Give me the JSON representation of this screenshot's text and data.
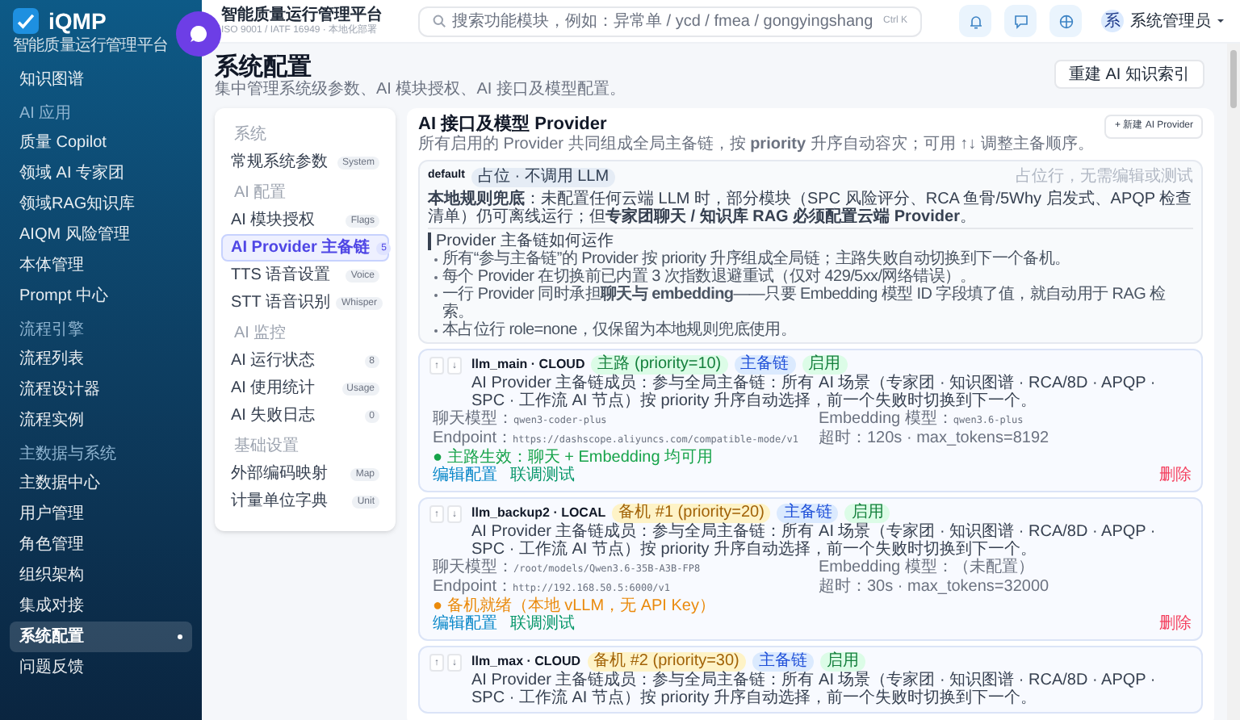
{
  "sidebar": {
    "logo_title": "iQMP",
    "logo_subtitle": "智能质量运行管理平台",
    "items": [
      {
        "kind": "item",
        "label": "知识图谱",
        "selected": false
      },
      {
        "kind": "heading",
        "label": "AI 应用"
      },
      {
        "kind": "item",
        "label": "质量 Copilot",
        "selected": false
      },
      {
        "kind": "item",
        "label": "领域 AI 专家团",
        "selected": false
      },
      {
        "kind": "item",
        "label": "领域RAG知识库",
        "selected": false
      },
      {
        "kind": "item",
        "label": "AIQM 风险管理",
        "selected": false
      },
      {
        "kind": "item",
        "label": "本体管理",
        "selected": false
      },
      {
        "kind": "item",
        "label": "Prompt 中心",
        "selected": false
      },
      {
        "kind": "heading",
        "label": "流程引擎"
      },
      {
        "kind": "item",
        "label": "流程列表",
        "selected": false
      },
      {
        "kind": "item",
        "label": "流程设计器",
        "selected": false
      },
      {
        "kind": "item",
        "label": "流程实例",
        "selected": false
      },
      {
        "kind": "heading",
        "label": "主数据与系统"
      },
      {
        "kind": "item",
        "label": "主数据中心",
        "selected": false
      },
      {
        "kind": "item",
        "label": "用户管理",
        "selected": false
      },
      {
        "kind": "item",
        "label": "角色管理",
        "selected": false
      },
      {
        "kind": "item",
        "label": "组织架构",
        "selected": false
      },
      {
        "kind": "item",
        "label": "集成对接",
        "selected": false
      },
      {
        "kind": "item",
        "label": "系统配置",
        "selected": true
      },
      {
        "kind": "item",
        "label": "问题反馈",
        "selected": false
      }
    ]
  },
  "header": {
    "title": "智能质量运行管理平台",
    "subtitle": "ISO 9001 / IATF 16949 · 本地化部署",
    "search": {
      "placeholder": "搜索功能模块，例如：异常单 / ycd / fmea / gongyingshang",
      "shortcut": "Ctrl K"
    },
    "user": {
      "avatar": "系",
      "name": "系统管理员"
    }
  },
  "page": {
    "title": "系统配置",
    "subtitle": "集中管理系统级参数、AI 模块授权、AI 接口及模型配置。",
    "button": "重建 AI 知识索引"
  },
  "config_nav": [
    {
      "heading": "系统",
      "items": [
        {
          "label": "常规系统参数",
          "badge": "System",
          "selected": false
        }
      ]
    },
    {
      "heading": "AI 配置",
      "items": [
        {
          "label": "AI 模块授权",
          "badge": "Flags",
          "selected": false
        },
        {
          "label": "AI Provider 主备链",
          "badge": "5",
          "selected": true
        },
        {
          "label": "TTS 语音设置",
          "badge": "Voice",
          "selected": false
        },
        {
          "label": "STT 语音识别",
          "badge": "Whisper",
          "selected": false
        }
      ]
    },
    {
      "heading": "AI 监控",
      "items": [
        {
          "label": "AI 运行状态",
          "badge": "8",
          "selected": false
        },
        {
          "label": "AI 使用统计",
          "badge": "Usage",
          "selected": false
        },
        {
          "label": "AI 失败日志",
          "badge": "0",
          "selected": false
        }
      ]
    },
    {
      "heading": "基础设置",
      "items": [
        {
          "label": "外部编码映射",
          "badge": "Map",
          "selected": false
        },
        {
          "label": "计量单位字典",
          "badge": "Unit",
          "selected": false
        }
      ]
    }
  ],
  "panel": {
    "title": "AI 接口及模型 Provider",
    "description": "所有启用的 Provider 共同组成全局主备链，按 **priority** 升序自动容灾；可用 ↑↓ 调整主备顺序。",
    "new_button": "+ 新建 AI Provider",
    "default_card": {
      "name": "default",
      "tag": "占位 · 不调用 LLM",
      "note": "占位行，无需编辑或测试",
      "notice": "**本地规则兜底**：未配置任何云端 LLM 时，部分模块（SPC 风险评分、RCA 鱼骨/5Why 启发式、APQP 检查清单）仍可离线运行；但**专家团聊天 / 知识库 RAG 必须配置云端 Provider**。",
      "help_title": "Provider 主备链如何运作",
      "help_items": [
        "所有“参与主备链”的 Provider 按 priority 升序组成全局链；主路失败自动切换到下一个备机。",
        "每个 Provider 在切换前已内置 3 次指数退避重试（仅对 429/5xx/网络错误）。",
        "一行 Provider 同时承担**聊天与 embedding**——只要 Embedding 模型 ID 字段填了值，就自动用于 RAG 检索。",
        "本占位行 role=none，仅保留为本地规则兜底使用。"
      ]
    },
    "providers": [
      {
        "up": "↑",
        "down": "↓",
        "name": "llm_main · CLOUD",
        "role": {
          "kind": "primary",
          "text": "主路 (priority=10)"
        },
        "chain": "主备链",
        "enabled": "启用",
        "description": "AI Provider 主备链成员：参与全局主备链：所有 AI 场景（专家团 · 知识图谱 · RCA/8D · APQP · SPC · 工作流 AI 节点）按 priority 升序自动选择，前一个失败时切换到下一个。",
        "fields": [
          {
            "label": "聊天模型：",
            "value": "qwen3-coder-plus",
            "mono": true
          },
          {
            "label": "Embedding 模型：",
            "value": "qwen3.6-plus",
            "mono": true
          },
          {
            "label": "Endpoint：",
            "value": "https://dashscope.aliyuncs.com/compatible-mode/v1",
            "mono": true
          },
          {
            "label": "超时：",
            "value": "120s · max_tokens=8192",
            "mono": false
          }
        ],
        "status": {
          "kind": "ok",
          "text": "● 主路生效：聊天 + Embedding 均可用"
        },
        "actions": [
          "编辑配置",
          "联调测试"
        ],
        "delete": "删除"
      },
      {
        "up": "↑",
        "down": "↓",
        "name": "llm_backup2 · LOCAL",
        "role": {
          "kind": "backup",
          "text": "备机 #1 (priority=20)"
        },
        "chain": "主备链",
        "enabled": "启用",
        "description": "AI Provider 主备链成员：参与全局主备链：所有 AI 场景（专家团 · 知识图谱 · RCA/8D · APQP · SPC · 工作流 AI 节点）按 priority 升序自动选择，前一个失败时切换到下一个。",
        "fields": [
          {
            "label": "聊天模型：",
            "value": "/root/models/Qwen3.6-35B-A3B-FP8",
            "mono": true
          },
          {
            "label": "Embedding 模型：",
            "value": "（未配置）",
            "mono": false
          },
          {
            "label": "Endpoint：",
            "value": "http://192.168.50.5:6000/v1",
            "mono": true
          },
          {
            "label": "超时：",
            "value": "30s · max_tokens=32000",
            "mono": false
          }
        ],
        "status": {
          "kind": "warn",
          "text": "● 备机就绪（本地 vLLM，无 API Key）"
        },
        "actions": [
          "编辑配置",
          "联调测试"
        ],
        "delete": "删除"
      },
      {
        "up": "↑",
        "down": "↓",
        "name": "llm_max · CLOUD",
        "role": {
          "kind": "backup",
          "text": "备机 #2 (priority=30)"
        },
        "chain": "主备链",
        "enabled": "启用",
        "description": "AI Provider 主备链成员：参与全局主备链：所有 AI 场景（专家团 · 知识图谱 · RCA/8D · APQP · SPC · 工作流 AI 节点）按 priority 升序自动选择，前一个失败时切换到下一个。"
      }
    ]
  }
}
